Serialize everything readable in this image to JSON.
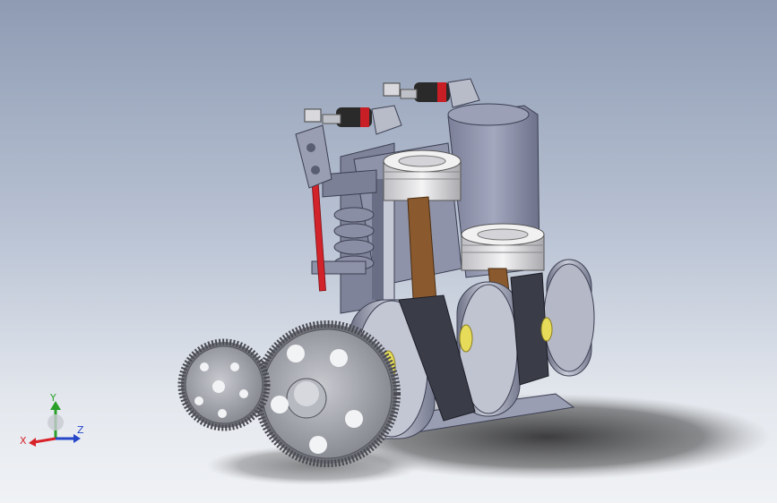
{
  "viewport": {
    "model": "engine-assembly",
    "colors": {
      "background_top": "#8e9bb3",
      "background_bottom": "#f0f2f5",
      "block": "#8c91a8",
      "block_dark": "#5e627a",
      "crank_web": "#3a3c48",
      "connecting_rod": "#8a5a2e",
      "piston": "#e9e9ea",
      "gear": "#a7a9b0",
      "push_rod": "#d2222a",
      "bearing": "#e6dc5a",
      "shadow": "#2b2b2b"
    }
  },
  "triad": {
    "x_label": "X",
    "y_label": "Y",
    "z_label": "Z",
    "x_color": "#d8232a",
    "y_color": "#2aa02a",
    "z_color": "#2546c8"
  }
}
